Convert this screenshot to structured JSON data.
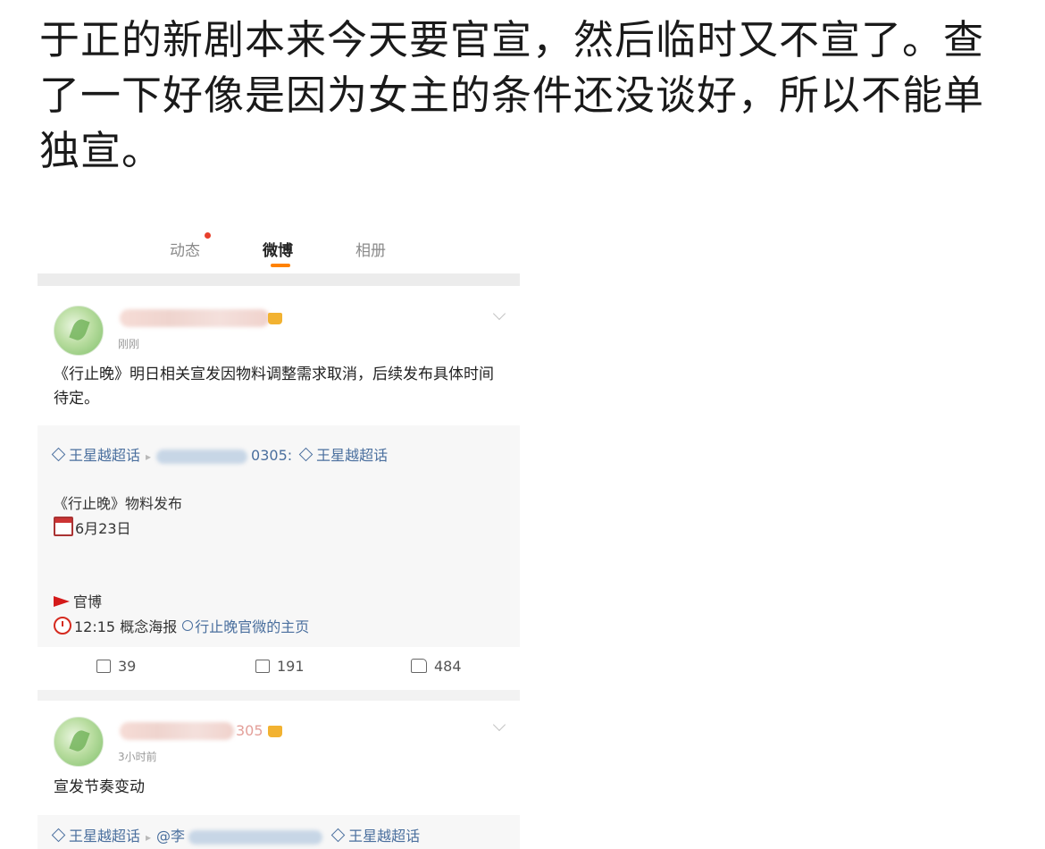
{
  "headline": "于正的新剧本来今天要官宣，然后临时又不宣了。查了一下好像是因为女主的条件还没谈好，所以不能单独宣。",
  "tabs": {
    "dynamic": "动态",
    "weibo": "微博",
    "album": "相册"
  },
  "post1": {
    "time": "刚刚",
    "text": "《行止晚》明日相关宣发因物料调整需求取消，后续发布具体时间待定。",
    "repost": {
      "topic": "王星越超话",
      "mention_tail": "0305:",
      "topic2": "王星越超话",
      "line_title": "《行止晚》物料发布",
      "date": "6月23日",
      "source": "官博",
      "time_poster": "12:15 概念海报",
      "homepage_link": "行止晚官微的主页"
    },
    "actions": {
      "reposts": "39",
      "comments": "191",
      "likes": "484"
    }
  },
  "post2": {
    "name_tail": "305",
    "time": "3小时前",
    "text": "宣发节奏变动",
    "repost": {
      "topic": "王星越超话",
      "mention_head": "@李",
      "topic2": "王星越超话"
    }
  },
  "colors": {
    "accent": "#ff8200",
    "link": "#4a6f9e",
    "dot": "#e8402c"
  },
  "icons": [
    "diamond-icon",
    "calendar-icon",
    "flag-icon",
    "clock-icon",
    "user-icon",
    "repost-icon",
    "comment-icon",
    "like-icon",
    "chevron-down-icon"
  ]
}
